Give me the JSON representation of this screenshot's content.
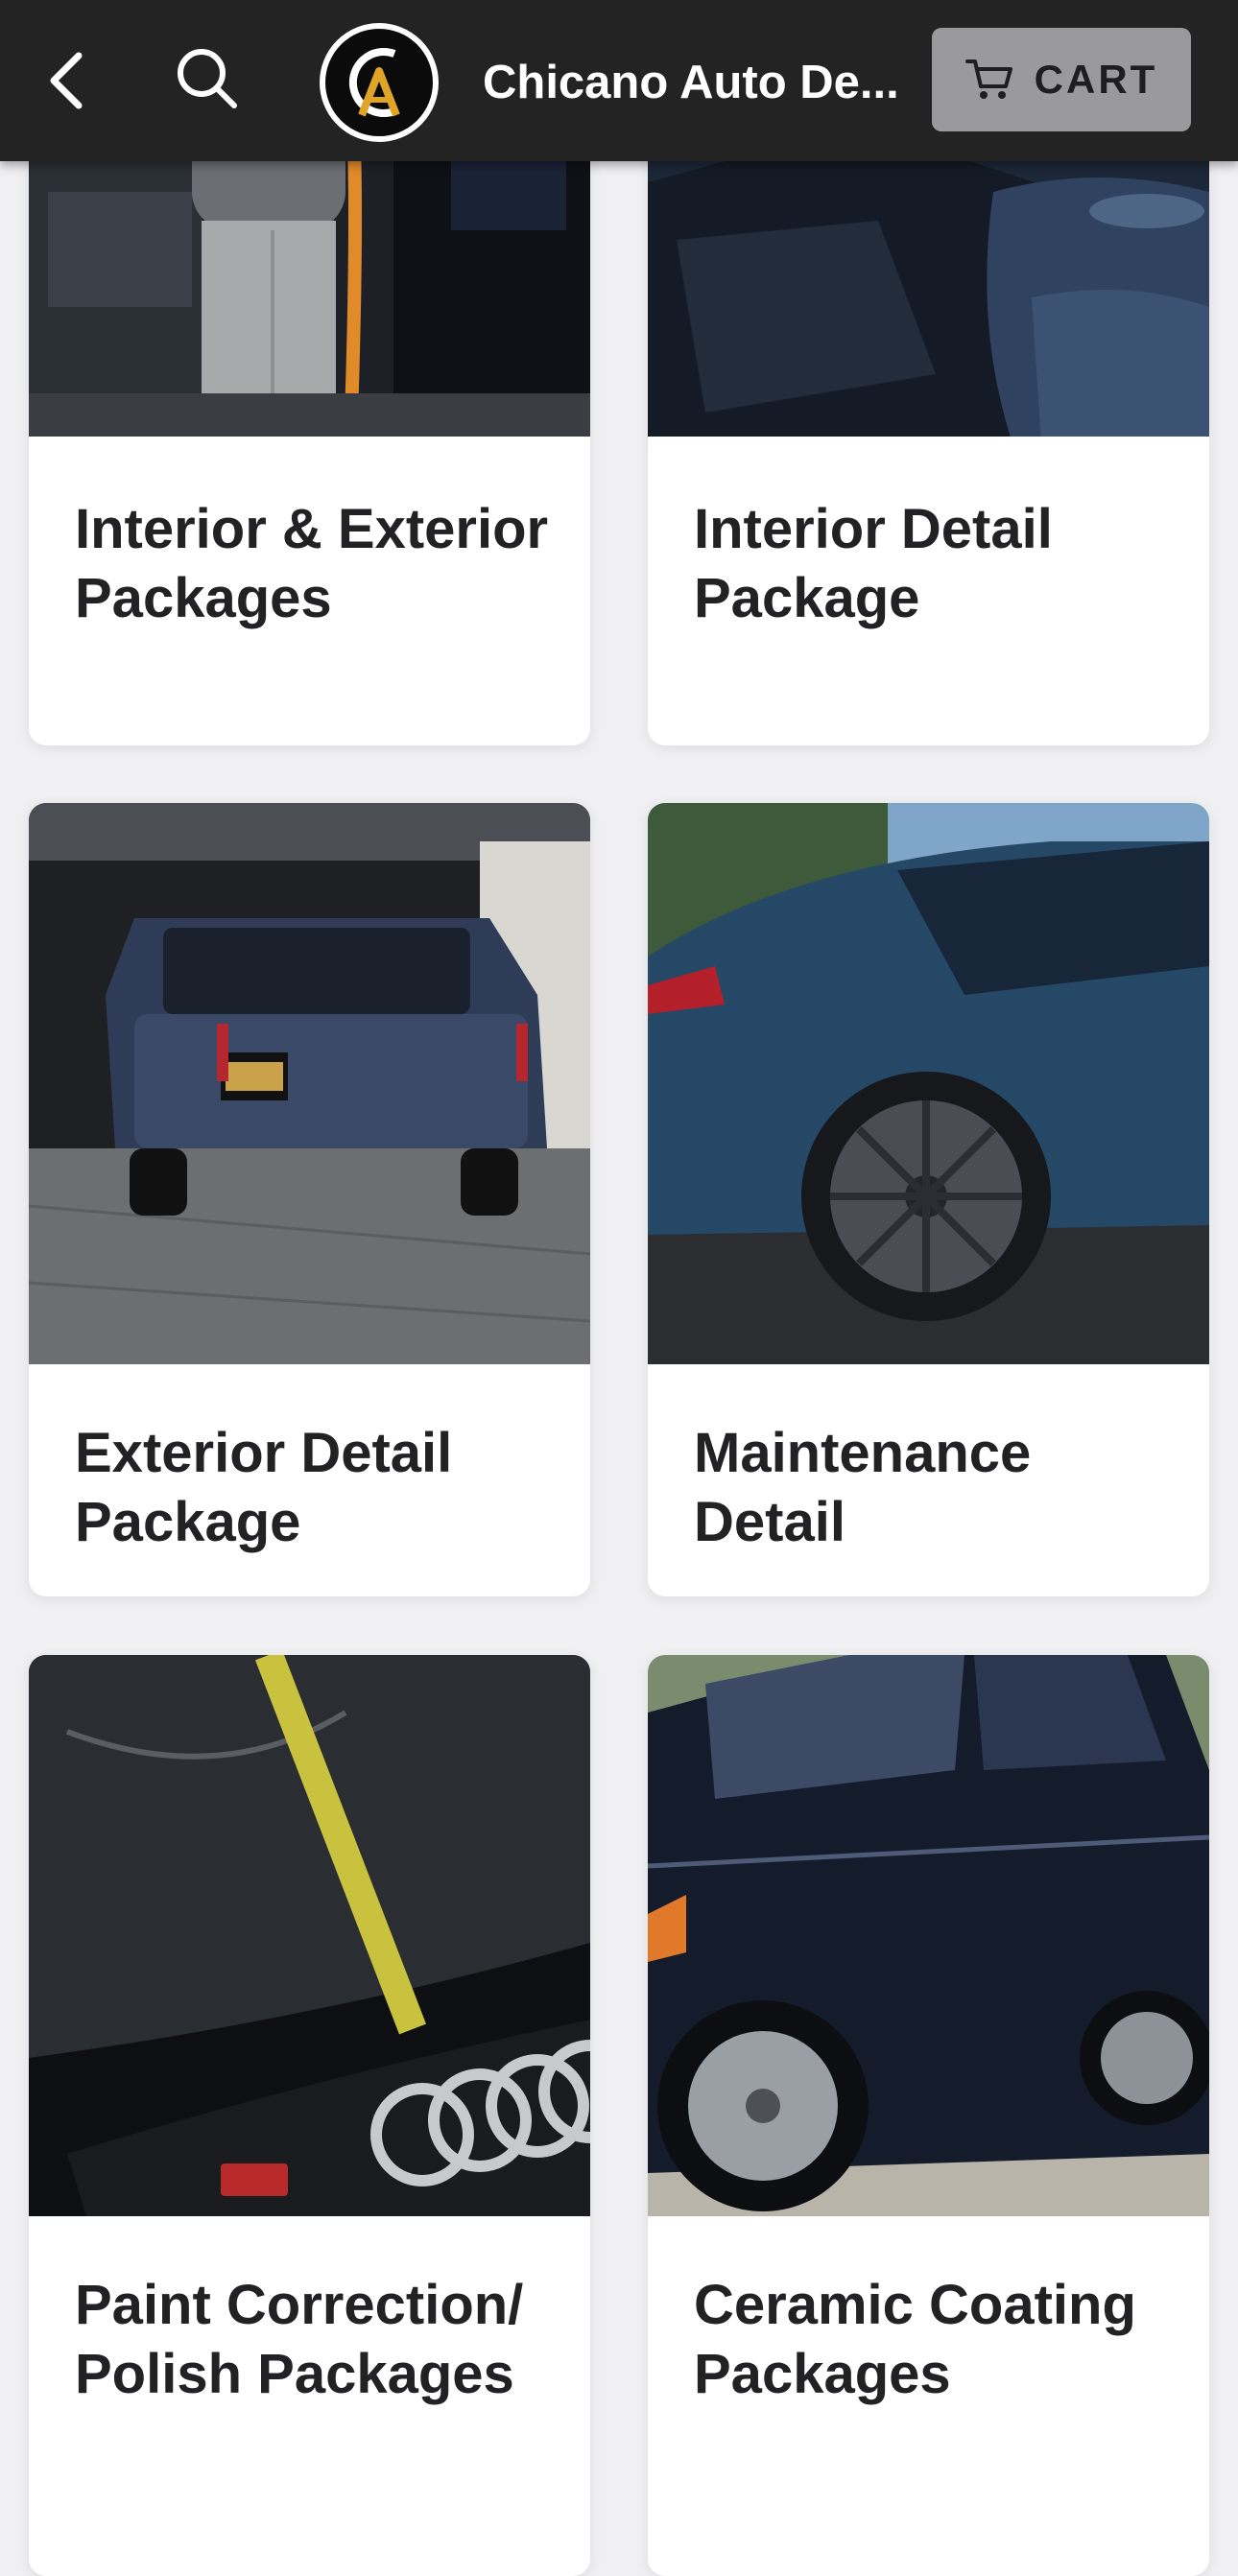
{
  "header": {
    "back_icon": "chevron-left-icon",
    "search_icon": "search-icon",
    "logo_text": "CA",
    "title": "Chicano Auto De...",
    "cart_icon": "cart-icon",
    "cart_label": "CART"
  },
  "products": [
    {
      "title": "Interior & Exterior Packages",
      "image": "interior-vacuum-photo"
    },
    {
      "title": "Interior Detail Package",
      "image": "interior-seats-photo"
    },
    {
      "title": "Exterior Detail Package",
      "image": "blue-suv-rear-photo"
    },
    {
      "title": "Maintenance Detail",
      "image": "blue-sedan-wheel-photo"
    },
    {
      "title": "Paint Correction/ Polish Packages",
      "image": "audi-hood-tape-photo"
    },
    {
      "title": "Ceramic Coating Packages",
      "image": "black-sedan-side-photo"
    }
  ],
  "colors": {
    "header_bg": "#232324",
    "cart_bg": "#9a9a9c",
    "page_bg": "#f0f0f3",
    "logo_gold": "#e0a526"
  }
}
